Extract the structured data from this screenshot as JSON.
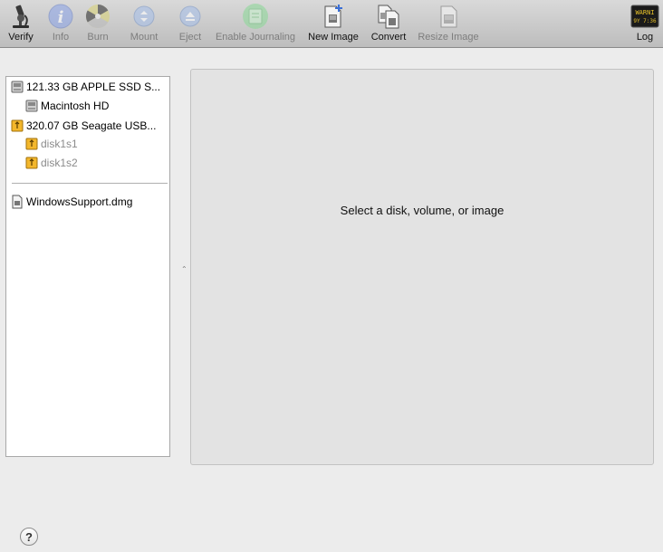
{
  "toolbar": {
    "verify": "Verify",
    "info": "Info",
    "burn": "Burn",
    "mount": "Mount",
    "eject": "Eject",
    "enable_journaling": "Enable Journaling",
    "new_image": "New Image",
    "convert": "Convert",
    "resize_image": "Resize Image",
    "log": "Log",
    "log_icon_text_1": "WARNI",
    "log_icon_text_2": "9Y 7:36"
  },
  "sidebar": {
    "items": [
      {
        "label": "121.33 GB APPLE SSD S..."
      },
      {
        "label": "Macintosh HD"
      },
      {
        "label": "320.07 GB Seagate USB..."
      },
      {
        "label": "disk1s1"
      },
      {
        "label": "disk1s2"
      }
    ],
    "images": [
      {
        "label": "WindowsSupport.dmg"
      }
    ]
  },
  "main": {
    "message": "Select a disk, volume, or image"
  },
  "help": {
    "label": "?"
  }
}
